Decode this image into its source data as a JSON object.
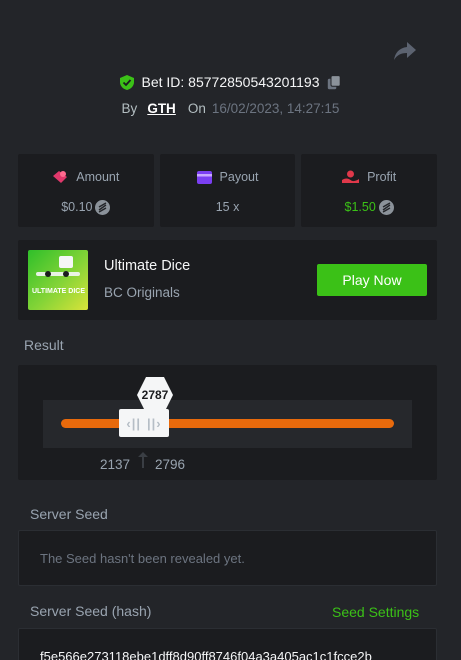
{
  "header": {
    "bet_id_label": "Bet ID:",
    "bet_id": "85772850543201193",
    "by_label": "By",
    "user": "GTH",
    "on_label": "On",
    "date": "16/02/2023, 14:27:15"
  },
  "stats": {
    "amount": {
      "label": "Amount",
      "value": "$0.10"
    },
    "payout": {
      "label": "Payout",
      "value": "15 x"
    },
    "profit": {
      "label": "Profit",
      "value": "$1.50"
    }
  },
  "game": {
    "thumb_text": "ULTIMATE DICE",
    "name": "Ultimate Dice",
    "provider": "BC Originals",
    "play_label": "Play Now"
  },
  "result": {
    "label": "Result",
    "value": "2787",
    "range_low": "2137",
    "range_high": "2796"
  },
  "server_seed": {
    "label": "Server Seed",
    "text": "The Seed hasn't been revealed yet."
  },
  "server_seed_hash": {
    "label": "Server Seed (hash)",
    "settings_label": "Seed Settings",
    "hash": "f5e566e273118ebe1dff8d90ff8746f04a3a405ac1c1fcce2b"
  },
  "colors": {
    "accent_green": "#3bc117",
    "track_orange": "#e86a0c",
    "background": "#232529",
    "panel": "#1b1c1f"
  },
  "icons": {
    "share": "share-arrow-icon",
    "verified": "shield-check-icon",
    "copy": "copy-icon",
    "amount": "bet-chip-icon",
    "payout": "card-icon",
    "profit": "profit-icon",
    "coin": "coin-icon"
  }
}
